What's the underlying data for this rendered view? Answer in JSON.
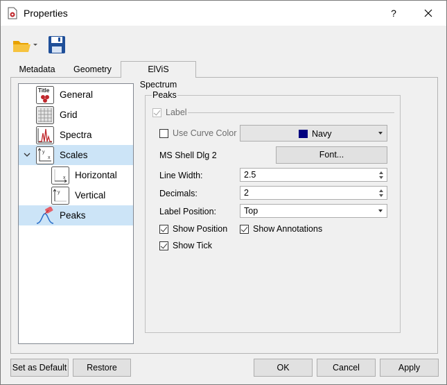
{
  "window": {
    "title": "Properties",
    "help": "?"
  },
  "tabs": [
    {
      "label": "Metadata"
    },
    {
      "label": "Geometry"
    },
    {
      "label": "ElViS Spectrum"
    }
  ],
  "tree": {
    "items": [
      {
        "label": "General",
        "icon": "title-icon"
      },
      {
        "label": "Grid",
        "icon": "grid-icon"
      },
      {
        "label": "Spectra",
        "icon": "spectra-icon"
      },
      {
        "label": "Scales",
        "icon": "scales-icon"
      },
      {
        "label": "Horizontal",
        "icon": "horizontal-scale-icon"
      },
      {
        "label": "Vertical",
        "icon": "vertical-scale-icon"
      },
      {
        "label": "Peaks",
        "icon": "peaks-icon"
      }
    ]
  },
  "peaks": {
    "group_title": "Peaks",
    "label_checkbox": "Label",
    "use_curve_color": "Use Curve Color",
    "color_value": "Navy",
    "color_hex": "#000080",
    "font_name": "MS Shell Dlg 2",
    "font_button": "Font...",
    "line_width_label": "Line Width:",
    "line_width_value": "2.5",
    "decimals_label": "Decimals:",
    "decimals_value": "2",
    "label_position_label": "Label Position:",
    "label_position_value": "Top",
    "show_position": "Show Position",
    "show_annotations": "Show Annotations",
    "show_tick": "Show Tick"
  },
  "buttons": {
    "set_default": "Set as Default",
    "restore": "Restore",
    "ok": "OK",
    "cancel": "Cancel",
    "apply": "Apply"
  }
}
